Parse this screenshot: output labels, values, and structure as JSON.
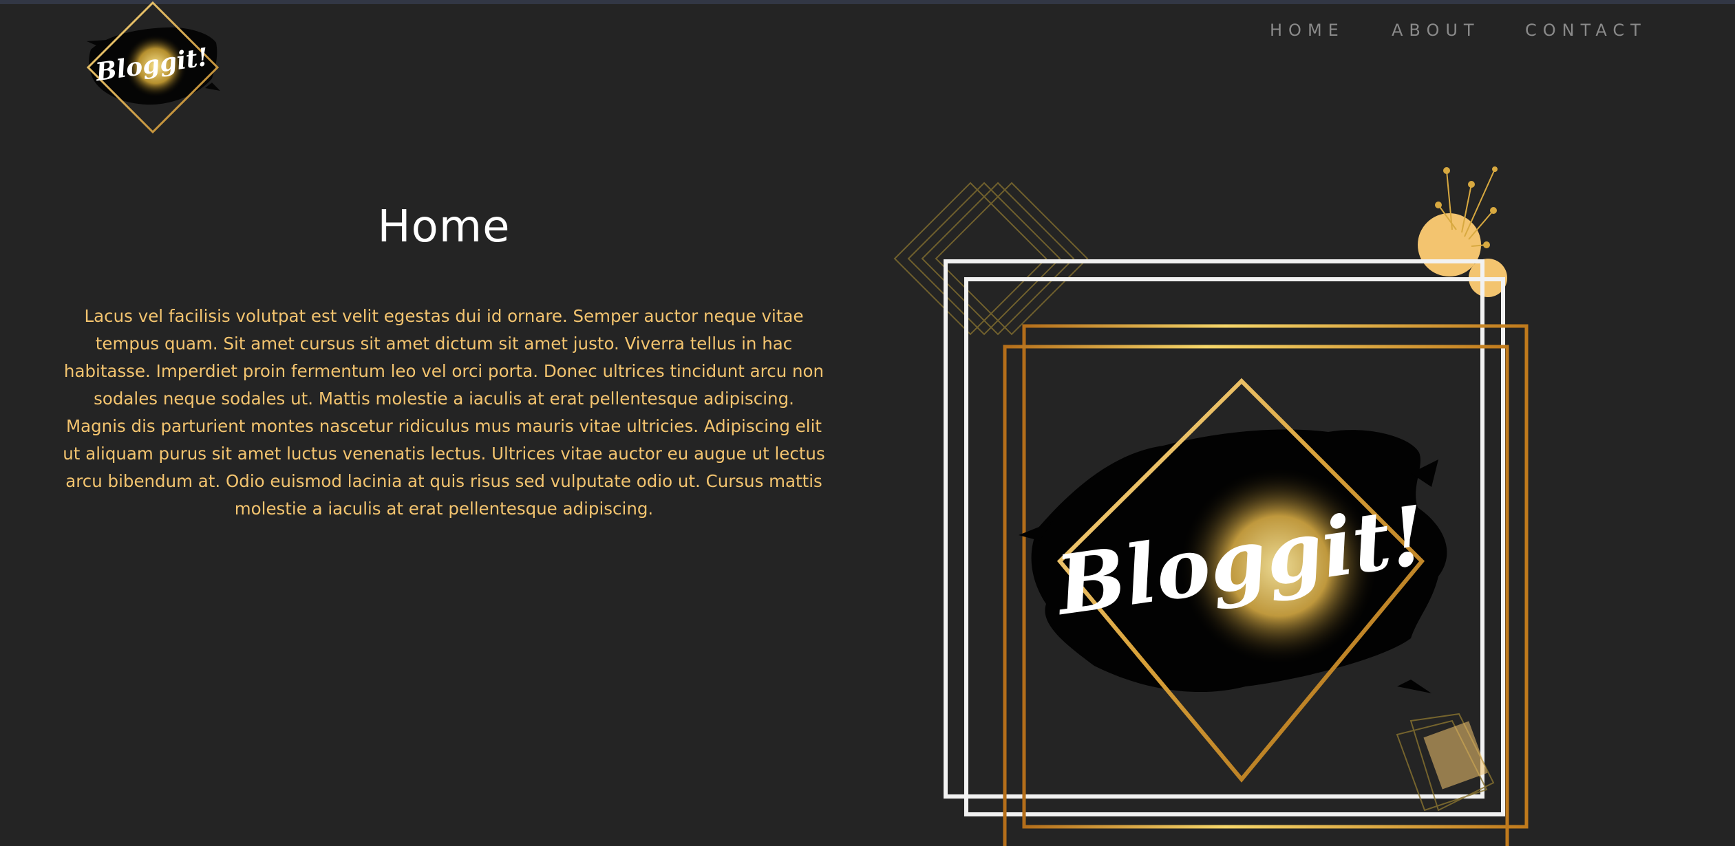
{
  "brand": {
    "logo_text": "Bloggit!"
  },
  "nav": {
    "items": [
      {
        "label": "HOME"
      },
      {
        "label": "ABOUT"
      },
      {
        "label": "CONTACT"
      }
    ]
  },
  "main": {
    "title": "Home",
    "paragraph": "Lacus vel facilisis volutpat est velit egestas dui id ornare. Semper auctor neque vitae tempus quam. Sit amet cursus sit amet dictum sit amet justo. Viverra tellus in hac habitasse. Imperdiet proin fermentum leo vel orci porta. Donec ultrices tincidunt arcu non sodales neque sodales ut. Mattis molestie a iaculis at erat pellentesque adipiscing. Magnis dis parturient montes nascetur ridiculus mus mauris vitae ultricies. Adipiscing elit ut aliquam purus sit amet luctus venenatis lectus. Ultrices vitae auctor eu augue ut lectus arcu bibendum at. Odio euismod lacinia at quis risus sed vulputate odio ut. Cursus mattis molestie a iaculis at erat pellentesque adipiscing."
  },
  "colors": {
    "background": "#242424",
    "accent_gold": "#f3c46f",
    "nav_text": "#8a8a8a",
    "title_text": "#ffffff"
  }
}
